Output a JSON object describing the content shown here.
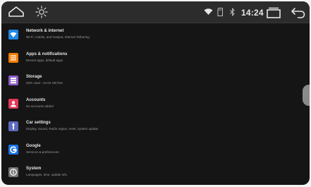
{
  "status_bar": {
    "time": "14:24",
    "icons": [
      "home-icon",
      "brightness-icon",
      "wifi-icon",
      "sd-card-icon",
      "bluetooth-icon",
      "recents-icon",
      "back-icon"
    ]
  },
  "settings": {
    "items": [
      {
        "title": "Network & internet",
        "subtitle": "Wi-Fi, mobile, and hotspot, Internet Tethering",
        "icon": "wifi-icon",
        "color": "#1e88e5"
      },
      {
        "title": "Apps & notifications",
        "subtitle": "Recent apps, default apps",
        "icon": "apps-icon",
        "color": "#f57c00"
      },
      {
        "title": "Storage",
        "subtitle": "25% used - 24.02 GB free",
        "icon": "storage-icon",
        "color": "#8e5cc7"
      },
      {
        "title": "Accounts",
        "subtitle": "No accounts added",
        "icon": "account-icon",
        "color": "#e53958"
      },
      {
        "title": "Car settings",
        "subtitle": "Display, Sound, Radio region, reset, system update",
        "icon": "car-settings-icon",
        "color": "#5c6bc0"
      },
      {
        "title": "Google",
        "subtitle": "Services & preferences",
        "icon": "google-icon",
        "color": "#1a73e8"
      },
      {
        "title": "System",
        "subtitle": "Languages, time, update info",
        "icon": "system-info-icon",
        "color": "#757575"
      }
    ]
  }
}
